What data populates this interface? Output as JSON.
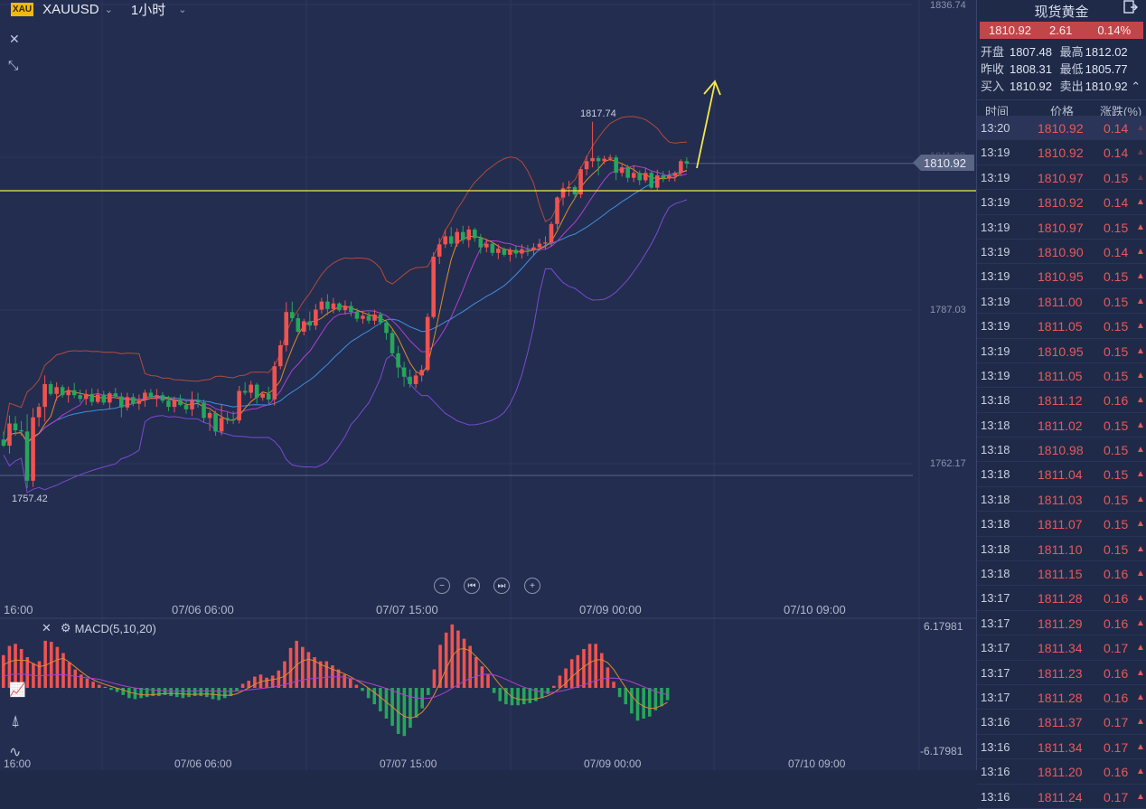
{
  "header": {
    "badge": "XAU",
    "symbol": "XAUUSD",
    "interval": "1小时"
  },
  "colors": {
    "up": "#ef5350",
    "down": "#26a65b",
    "trendline": "#f5e94a",
    "bb": "#b04a3e",
    "ma_orange": "#e08a30",
    "ma_purple": "#b03fd0",
    "ma_blue": "#3f8fe0",
    "bb_lower": "#7a4ad0"
  },
  "chart": {
    "ymax_label": "1836.74",
    "price_labels": [
      "1787.03",
      "1762.17"
    ],
    "current_price_tag": "1810.92",
    "faint_label": "1811.88",
    "high_annotation": "1817.74",
    "low_annotation": "1757.42",
    "x_labels": [
      "16:00",
      "07/06 06:00",
      "07/07 15:00",
      "07/09 00:00",
      "07/10 09:00"
    ],
    "horizontal_line_price": 1806.5,
    "candles": [
      {
        "o": 1766.1,
        "h": 1767.4,
        "l": 1764.9,
        "c": 1765.1
      },
      {
        "o": 1765.1,
        "h": 1770.0,
        "l": 1763.8,
        "c": 1768.7
      },
      {
        "o": 1768.7,
        "h": 1769.9,
        "l": 1766.7,
        "c": 1767.6
      },
      {
        "o": 1767.6,
        "h": 1769.1,
        "l": 1766.7,
        "c": 1767.4
      },
      {
        "o": 1767.4,
        "h": 1770.2,
        "l": 1758.2,
        "c": 1759.4
      },
      {
        "o": 1759.4,
        "h": 1771.2,
        "l": 1758.4,
        "c": 1769.7
      },
      {
        "o": 1769.7,
        "h": 1772.0,
        "l": 1768.2,
        "c": 1771.4
      },
      {
        "o": 1771.4,
        "h": 1776.5,
        "l": 1769.0,
        "c": 1775.1
      },
      {
        "o": 1775.1,
        "h": 1775.6,
        "l": 1773.2,
        "c": 1773.5
      },
      {
        "o": 1773.5,
        "h": 1775.4,
        "l": 1772.4,
        "c": 1774.6
      },
      {
        "o": 1774.6,
        "h": 1775.0,
        "l": 1772.9,
        "c": 1773.3
      },
      {
        "o": 1773.3,
        "h": 1774.7,
        "l": 1772.1,
        "c": 1774.1
      },
      {
        "o": 1774.1,
        "h": 1775.3,
        "l": 1772.8,
        "c": 1773.3
      },
      {
        "o": 1773.3,
        "h": 1774.2,
        "l": 1772.1,
        "c": 1772.7
      },
      {
        "o": 1772.7,
        "h": 1774.2,
        "l": 1771.7,
        "c": 1773.5
      },
      {
        "o": 1773.5,
        "h": 1774.4,
        "l": 1771.6,
        "c": 1772.2
      },
      {
        "o": 1772.2,
        "h": 1774.3,
        "l": 1771.9,
        "c": 1773.4
      },
      {
        "o": 1773.4,
        "h": 1774.0,
        "l": 1771.7,
        "c": 1772.1
      },
      {
        "o": 1772.1,
        "h": 1773.9,
        "l": 1771.0,
        "c": 1773.6
      },
      {
        "o": 1773.6,
        "h": 1774.5,
        "l": 1772.8,
        "c": 1773.1
      },
      {
        "o": 1773.1,
        "h": 1773.7,
        "l": 1769.7,
        "c": 1771.3
      },
      {
        "o": 1771.3,
        "h": 1773.7,
        "l": 1770.8,
        "c": 1773.0
      },
      {
        "o": 1773.0,
        "h": 1773.6,
        "l": 1771.5,
        "c": 1771.9
      },
      {
        "o": 1771.9,
        "h": 1773.4,
        "l": 1770.9,
        "c": 1772.5
      },
      {
        "o": 1772.5,
        "h": 1774.2,
        "l": 1771.4,
        "c": 1773.7
      },
      {
        "o": 1773.7,
        "h": 1774.3,
        "l": 1772.8,
        "c": 1773.0
      },
      {
        "o": 1773.0,
        "h": 1774.3,
        "l": 1771.4,
        "c": 1773.3
      },
      {
        "o": 1773.3,
        "h": 1773.8,
        "l": 1772.0,
        "c": 1772.4
      },
      {
        "o": 1772.4,
        "h": 1773.2,
        "l": 1770.7,
        "c": 1771.4
      },
      {
        "o": 1771.4,
        "h": 1773.1,
        "l": 1770.5,
        "c": 1772.5
      },
      {
        "o": 1772.5,
        "h": 1773.4,
        "l": 1771.5,
        "c": 1771.7
      },
      {
        "o": 1771.7,
        "h": 1772.6,
        "l": 1770.3,
        "c": 1771.0
      },
      {
        "o": 1771.0,
        "h": 1773.9,
        "l": 1769.9,
        "c": 1772.5
      },
      {
        "o": 1772.5,
        "h": 1773.7,
        "l": 1771.3,
        "c": 1772.1
      },
      {
        "o": 1772.1,
        "h": 1772.6,
        "l": 1768.9,
        "c": 1769.6
      },
      {
        "o": 1769.6,
        "h": 1770.8,
        "l": 1767.5,
        "c": 1770.4
      },
      {
        "o": 1770.4,
        "h": 1770.8,
        "l": 1766.7,
        "c": 1767.4
      },
      {
        "o": 1767.4,
        "h": 1771.8,
        "l": 1766.8,
        "c": 1769.6
      },
      {
        "o": 1769.6,
        "h": 1770.5,
        "l": 1768.6,
        "c": 1769.4
      },
      {
        "o": 1769.4,
        "h": 1770.7,
        "l": 1768.6,
        "c": 1769.2
      },
      {
        "o": 1769.2,
        "h": 1774.8,
        "l": 1768.7,
        "c": 1774.0
      },
      {
        "o": 1774.0,
        "h": 1775.4,
        "l": 1773.3,
        "c": 1773.7
      },
      {
        "o": 1773.7,
        "h": 1775.6,
        "l": 1772.8,
        "c": 1775.0
      },
      {
        "o": 1775.0,
        "h": 1775.3,
        "l": 1771.9,
        "c": 1772.9
      },
      {
        "o": 1772.9,
        "h": 1773.9,
        "l": 1772.4,
        "c": 1773.5
      },
      {
        "o": 1773.5,
        "h": 1774.7,
        "l": 1771.8,
        "c": 1772.6
      },
      {
        "o": 1772.6,
        "h": 1778.8,
        "l": 1771.6,
        "c": 1778.0
      },
      {
        "o": 1778.0,
        "h": 1782.2,
        "l": 1777.5,
        "c": 1781.4
      },
      {
        "o": 1781.4,
        "h": 1788.4,
        "l": 1780.4,
        "c": 1786.8
      },
      {
        "o": 1786.8,
        "h": 1788.5,
        "l": 1785.3,
        "c": 1785.8
      },
      {
        "o": 1785.8,
        "h": 1786.6,
        "l": 1783.4,
        "c": 1783.6
      },
      {
        "o": 1783.6,
        "h": 1785.7,
        "l": 1783.0,
        "c": 1785.3
      },
      {
        "o": 1785.3,
        "h": 1786.9,
        "l": 1783.8,
        "c": 1784.6
      },
      {
        "o": 1784.6,
        "h": 1788.1,
        "l": 1783.9,
        "c": 1787.2
      },
      {
        "o": 1787.2,
        "h": 1789.1,
        "l": 1786.5,
        "c": 1788.5
      },
      {
        "o": 1788.5,
        "h": 1789.7,
        "l": 1786.3,
        "c": 1787.3
      },
      {
        "o": 1787.3,
        "h": 1789.1,
        "l": 1786.6,
        "c": 1788.2
      },
      {
        "o": 1788.2,
        "h": 1788.4,
        "l": 1786.8,
        "c": 1787.1
      },
      {
        "o": 1787.1,
        "h": 1788.7,
        "l": 1786.4,
        "c": 1787.8
      },
      {
        "o": 1787.8,
        "h": 1788.5,
        "l": 1786.1,
        "c": 1786.8
      },
      {
        "o": 1786.8,
        "h": 1787.4,
        "l": 1785.2,
        "c": 1785.7
      },
      {
        "o": 1785.7,
        "h": 1787.0,
        "l": 1784.9,
        "c": 1786.2
      },
      {
        "o": 1786.2,
        "h": 1786.8,
        "l": 1784.9,
        "c": 1785.4
      },
      {
        "o": 1785.4,
        "h": 1787.2,
        "l": 1784.7,
        "c": 1786.4
      },
      {
        "o": 1786.4,
        "h": 1786.8,
        "l": 1784.7,
        "c": 1785.1
      },
      {
        "o": 1785.1,
        "h": 1785.6,
        "l": 1782.3,
        "c": 1783.4
      },
      {
        "o": 1783.4,
        "h": 1783.9,
        "l": 1779.6,
        "c": 1780.1
      },
      {
        "o": 1780.1,
        "h": 1781.3,
        "l": 1776.1,
        "c": 1777.8
      },
      {
        "o": 1777.8,
        "h": 1778.7,
        "l": 1774.7,
        "c": 1776.3
      },
      {
        "o": 1776.3,
        "h": 1777.5,
        "l": 1774.5,
        "c": 1775.1
      },
      {
        "o": 1775.1,
        "h": 1777.2,
        "l": 1774.4,
        "c": 1776.5
      },
      {
        "o": 1776.5,
        "h": 1778.2,
        "l": 1775.5,
        "c": 1777.4
      },
      {
        "o": 1777.4,
        "h": 1786.6,
        "l": 1777.1,
        "c": 1786.0
      },
      {
        "o": 1786.0,
        "h": 1796.5,
        "l": 1785.7,
        "c": 1795.8
      },
      {
        "o": 1795.8,
        "h": 1798.8,
        "l": 1794.6,
        "c": 1797.8
      },
      {
        "o": 1797.8,
        "h": 1800.2,
        "l": 1797.2,
        "c": 1799.1
      },
      {
        "o": 1799.1,
        "h": 1800.6,
        "l": 1797.4,
        "c": 1797.9
      },
      {
        "o": 1797.9,
        "h": 1800.4,
        "l": 1797.4,
        "c": 1799.8
      },
      {
        "o": 1799.8,
        "h": 1800.8,
        "l": 1797.9,
        "c": 1798.5
      },
      {
        "o": 1798.5,
        "h": 1800.8,
        "l": 1797.3,
        "c": 1800.2
      },
      {
        "o": 1800.2,
        "h": 1800.5,
        "l": 1798.2,
        "c": 1798.8
      },
      {
        "o": 1798.8,
        "h": 1799.5,
        "l": 1796.3,
        "c": 1797.3
      },
      {
        "o": 1797.3,
        "h": 1798.7,
        "l": 1796.5,
        "c": 1797.9
      },
      {
        "o": 1797.9,
        "h": 1798.2,
        "l": 1795.9,
        "c": 1796.4
      },
      {
        "o": 1796.4,
        "h": 1797.8,
        "l": 1795.4,
        "c": 1797.1
      },
      {
        "o": 1797.1,
        "h": 1797.3,
        "l": 1795.8,
        "c": 1796.1
      },
      {
        "o": 1796.1,
        "h": 1797.3,
        "l": 1795.0,
        "c": 1796.9
      },
      {
        "o": 1796.9,
        "h": 1797.6,
        "l": 1795.6,
        "c": 1796.3
      },
      {
        "o": 1796.3,
        "h": 1797.8,
        "l": 1795.5,
        "c": 1797.0
      },
      {
        "o": 1797.0,
        "h": 1797.7,
        "l": 1795.9,
        "c": 1796.9
      },
      {
        "o": 1796.9,
        "h": 1798.0,
        "l": 1796.0,
        "c": 1797.3
      },
      {
        "o": 1797.3,
        "h": 1798.7,
        "l": 1796.7,
        "c": 1797.9
      },
      {
        "o": 1797.9,
        "h": 1799.1,
        "l": 1797.0,
        "c": 1798.1
      },
      {
        "o": 1798.1,
        "h": 1801.5,
        "l": 1797.4,
        "c": 1801.1
      },
      {
        "o": 1801.1,
        "h": 1805.6,
        "l": 1800.3,
        "c": 1805.4
      },
      {
        "o": 1805.4,
        "h": 1807.8,
        "l": 1804.1,
        "c": 1806.9
      },
      {
        "o": 1806.9,
        "h": 1808.1,
        "l": 1805.6,
        "c": 1807.1
      },
      {
        "o": 1807.1,
        "h": 1807.4,
        "l": 1805.2,
        "c": 1805.9
      },
      {
        "o": 1805.9,
        "h": 1810.4,
        "l": 1805.3,
        "c": 1810.0
      },
      {
        "o": 1810.0,
        "h": 1812.2,
        "l": 1809.0,
        "c": 1811.3
      },
      {
        "o": 1811.3,
        "h": 1817.7,
        "l": 1810.3,
        "c": 1811.8
      },
      {
        "o": 1811.8,
        "h": 1812.2,
        "l": 1809.0,
        "c": 1811.3
      },
      {
        "o": 1811.3,
        "h": 1812.2,
        "l": 1810.8,
        "c": 1811.7
      },
      {
        "o": 1811.7,
        "h": 1812.4,
        "l": 1811.3,
        "c": 1811.9
      },
      {
        "o": 1811.9,
        "h": 1812.3,
        "l": 1808.2,
        "c": 1809.4
      },
      {
        "o": 1809.4,
        "h": 1810.8,
        "l": 1808.8,
        "c": 1810.3
      },
      {
        "o": 1810.3,
        "h": 1810.7,
        "l": 1807.9,
        "c": 1808.6
      },
      {
        "o": 1808.6,
        "h": 1810.6,
        "l": 1807.9,
        "c": 1809.4
      },
      {
        "o": 1809.4,
        "h": 1809.8,
        "l": 1807.4,
        "c": 1808.2
      },
      {
        "o": 1808.2,
        "h": 1810.2,
        "l": 1807.8,
        "c": 1809.4
      },
      {
        "o": 1809.4,
        "h": 1809.8,
        "l": 1806.8,
        "c": 1807.0
      },
      {
        "o": 1807.0,
        "h": 1809.9,
        "l": 1806.6,
        "c": 1809.0
      },
      {
        "o": 1809.0,
        "h": 1809.7,
        "l": 1807.9,
        "c": 1808.5
      },
      {
        "o": 1808.5,
        "h": 1809.8,
        "l": 1808.0,
        "c": 1809.0
      },
      {
        "o": 1809.0,
        "h": 1809.7,
        "l": 1808.0,
        "c": 1809.4
      },
      {
        "o": 1809.4,
        "h": 1811.6,
        "l": 1808.9,
        "c": 1811.3
      },
      {
        "o": 1811.3,
        "h": 1811.9,
        "l": 1810.1,
        "c": 1810.9
      }
    ]
  },
  "macd": {
    "label": "MACD(5,10,20)",
    "top_tick": "6.17981",
    "bottom_tick": "-6.17981",
    "x_labels": [
      "16:00",
      "07/06 06:00",
      "07/07 15:00",
      "07/09 00:00",
      "07/10 09:00"
    ],
    "histogram": [
      3.2,
      4.1,
      4.3,
      3.8,
      3.0,
      2.4,
      2.6,
      4.6,
      4.5,
      4.0,
      3.4,
      2.5,
      1.8,
      1.3,
      0.9,
      0.6,
      0.3,
      0.1,
      -0.2,
      -0.4,
      -0.7,
      -1.0,
      -1.1,
      -1.0,
      -0.9,
      -0.8,
      -0.8,
      -0.7,
      -0.8,
      -0.9,
      -1.0,
      -0.9,
      -0.8,
      -0.8,
      -0.9,
      -1.1,
      -1.2,
      -1.0,
      -0.8,
      -0.3,
      0.4,
      0.7,
      1.1,
      1.3,
      1.0,
      1.2,
      1.7,
      2.6,
      3.9,
      4.6,
      4.0,
      3.5,
      3.0,
      2.6,
      2.6,
      2.2,
      1.8,
      1.3,
      0.9,
      0.3,
      -0.3,
      -1.0,
      -1.6,
      -2.3,
      -3.0,
      -3.7,
      -4.5,
      -4.7,
      -3.9,
      -2.9,
      -2.0,
      -0.7,
      1.8,
      4.2,
      5.4,
      6.2,
      5.6,
      4.8,
      4.1,
      3.0,
      2.1,
      1.3,
      -0.5,
      -1.3,
      -1.6,
      -1.7,
      -1.7,
      -1.6,
      -1.5,
      -1.3,
      -1.0,
      -0.6,
      0.2,
      1.2,
      1.9,
      2.8,
      3.2,
      3.8,
      4.3,
      4.3,
      3.4,
      2.0,
      0.6,
      -0.9,
      -1.6,
      -2.5,
      -3.2,
      -3.0,
      -2.8,
      -2.2,
      -1.8,
      -1.2
    ]
  },
  "side": {
    "title": "现货黄金",
    "last": "1810.92",
    "change": "2.61",
    "change_pct": "0.14%",
    "open_label": "开盘",
    "open": "1807.48",
    "high_label": "最高",
    "high": "1812.02",
    "prev_label": "昨收",
    "prev": "1808.31",
    "low_label": "最低",
    "low": "1805.77",
    "buy_label": "买入",
    "buy": "1810.92",
    "sell_label": "卖出",
    "sell": "1810.92",
    "col_time": "时间",
    "col_price": "价格",
    "col_pct": "涨跌(%)",
    "rows": [
      {
        "t": "13:20",
        "p": "1810.92",
        "c": "0.14"
      },
      {
        "t": "13:19",
        "p": "1810.92",
        "c": "0.14"
      },
      {
        "t": "13:19",
        "p": "1810.97",
        "c": "0.15"
      },
      {
        "t": "13:19",
        "p": "1810.92",
        "c": "0.14"
      },
      {
        "t": "13:19",
        "p": "1810.97",
        "c": "0.15"
      },
      {
        "t": "13:19",
        "p": "1810.90",
        "c": "0.14"
      },
      {
        "t": "13:19",
        "p": "1810.95",
        "c": "0.15"
      },
      {
        "t": "13:19",
        "p": "1811.00",
        "c": "0.15"
      },
      {
        "t": "13:19",
        "p": "1811.05",
        "c": "0.15"
      },
      {
        "t": "13:19",
        "p": "1810.95",
        "c": "0.15"
      },
      {
        "t": "13:19",
        "p": "1811.05",
        "c": "0.15"
      },
      {
        "t": "13:18",
        "p": "1811.12",
        "c": "0.16"
      },
      {
        "t": "13:18",
        "p": "1811.02",
        "c": "0.15"
      },
      {
        "t": "13:18",
        "p": "1810.98",
        "c": "0.15"
      },
      {
        "t": "13:18",
        "p": "1811.04",
        "c": "0.15"
      },
      {
        "t": "13:18",
        "p": "1811.03",
        "c": "0.15"
      },
      {
        "t": "13:18",
        "p": "1811.07",
        "c": "0.15"
      },
      {
        "t": "13:18",
        "p": "1811.10",
        "c": "0.15"
      },
      {
        "t": "13:18",
        "p": "1811.15",
        "c": "0.16"
      },
      {
        "t": "13:17",
        "p": "1811.28",
        "c": "0.16"
      },
      {
        "t": "13:17",
        "p": "1811.29",
        "c": "0.16"
      },
      {
        "t": "13:17",
        "p": "1811.34",
        "c": "0.17"
      },
      {
        "t": "13:17",
        "p": "1811.23",
        "c": "0.16"
      },
      {
        "t": "13:17",
        "p": "1811.28",
        "c": "0.16"
      },
      {
        "t": "13:16",
        "p": "1811.37",
        "c": "0.17"
      },
      {
        "t": "13:16",
        "p": "1811.34",
        "c": "0.17"
      },
      {
        "t": "13:16",
        "p": "1811.20",
        "c": "0.16"
      },
      {
        "t": "13:16",
        "p": "1811.24",
        "c": "0.17"
      }
    ]
  }
}
